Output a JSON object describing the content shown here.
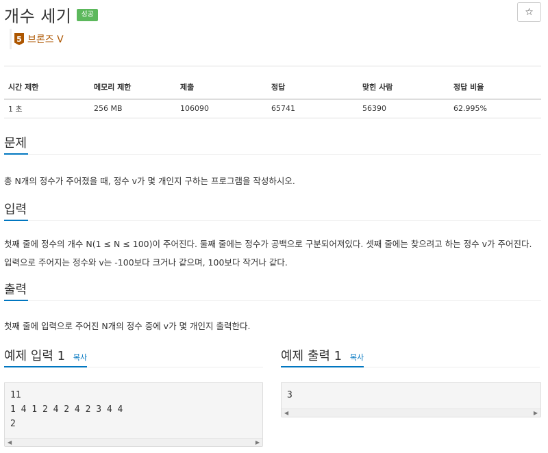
{
  "problem": {
    "title": "개수 세기",
    "status_badge": "성공",
    "star": "☆",
    "tier_number": "5",
    "tier_label": "브론즈 V"
  },
  "stats": {
    "headers": [
      "시간 제한",
      "메모리 제한",
      "제출",
      "정답",
      "맞힌 사람",
      "정답 비율"
    ],
    "values": [
      "1 초",
      "256 MB",
      "106090",
      "65741",
      "56390",
      "62.995%"
    ]
  },
  "sections": {
    "problem_heading": "문제",
    "problem_text": "총 N개의 정수가 주어졌을 때, 정수 v가 몇 개인지 구하는 프로그램을 작성하시오.",
    "input_heading": "입력",
    "input_text": "첫째 줄에 정수의 개수 N(1 ≤ N ≤ 100)이 주어진다. 둘째 줄에는 정수가 공백으로 구분되어져있다. 셋째 줄에는 찾으려고 하는 정수 v가 주어진다. 입력으로 주어지는 정수와 v는 -100보다 크거나 같으며, 100보다 작거나 같다.",
    "output_heading": "출력",
    "output_text": "첫째 줄에 입력으로 주어진 N개의 정수 중에 v가 몇 개인지 출력한다."
  },
  "samples": {
    "input_heading": "예제 입력 1",
    "output_heading": "예제 출력 1",
    "copy_label": "복사",
    "input_text": "11\n1 4 1 2 4 2 4 2 3 4 4\n2",
    "output_text": "3"
  },
  "icons": {
    "scroll_left": "◀",
    "scroll_right": "▶"
  },
  "colors": {
    "accent": "#0076c0",
    "success": "#5cb85c",
    "bronze": "#ad5600"
  }
}
